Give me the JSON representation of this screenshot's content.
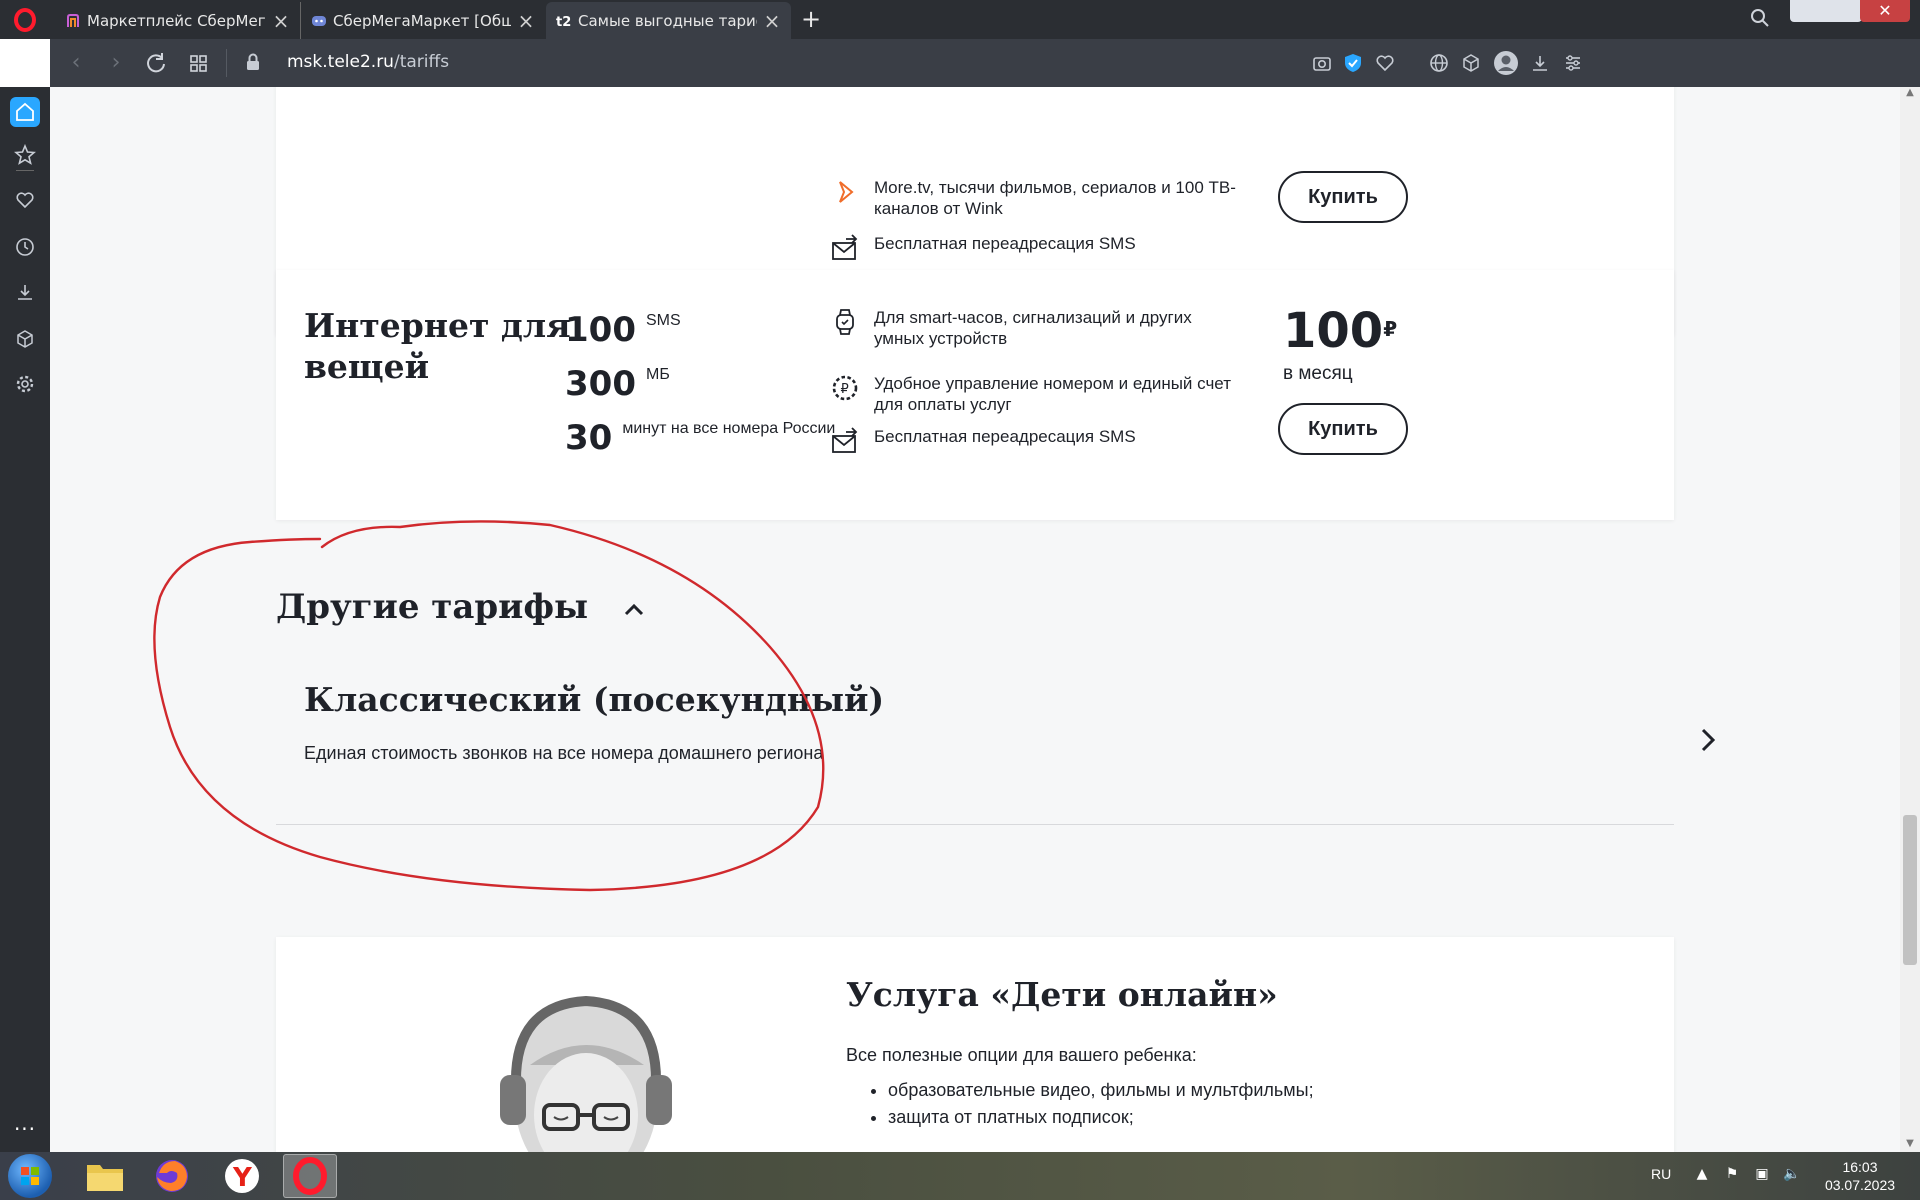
{
  "browser": {
    "tabs": [
      {
        "label": "Маркетплейс СберМегаМаркет",
        "active": false
      },
      {
        "label": "СберМегаМаркет [Общая",
        "active": false
      },
      {
        "label": "Самые выгодные тарифы",
        "active": true
      }
    ],
    "url_host": "msk.tele2.ru",
    "url_path": "/tariffs"
  },
  "top_card": {
    "features": [
      {
        "icon": "movie-icon",
        "text": "More.tv, тысячи фильмов, сериалов и 100 ТВ-каналов от Wink"
      },
      {
        "icon": "sms-forward-icon",
        "text": "Бесплатная переадресация SMS"
      }
    ],
    "buy_label": "Купить"
  },
  "iot_card": {
    "title": "Интернет для вещей",
    "metrics": [
      {
        "value": "100",
        "unit": "SMS"
      },
      {
        "value": "300",
        "unit": "МБ"
      },
      {
        "value": "30",
        "unit": "минут на все номера России"
      }
    ],
    "features": [
      {
        "icon": "smartwatch-icon",
        "text": "Для smart-часов, сигнализаций и других умных устройств"
      },
      {
        "icon": "ruble-gear-icon",
        "text": "Удобное управление номером и единый счет для оплаты услуг"
      },
      {
        "icon": "sms-forward-icon",
        "text": "Бесплатная переадресация SMS"
      }
    ],
    "price": "100",
    "currency": "₽",
    "period": "в месяц",
    "buy_label": "Купить"
  },
  "other_tariffs": {
    "heading": "Другие тарифы",
    "item": {
      "title": "Классический (посекундный)",
      "description": "Единая стоимость звонков на все номера домашнего региона"
    },
    "annotation_color": "#d0292d"
  },
  "kids_card": {
    "title": "Услуга «Дети онлайн»",
    "subtitle": "Все полезные опции для вашего ребенка:",
    "items": [
      "образовательные видео, фильмы и мультфильмы;",
      "защита от платных подписок;"
    ]
  },
  "taskbar": {
    "language": "RU",
    "time": "16:03",
    "date": "03.07.2023"
  },
  "colors": {
    "accent_blue": "#2aa7ff",
    "opera_red": "#ff1b2d",
    "text": "#1f2229",
    "page_bg": "#f6f7f8"
  }
}
